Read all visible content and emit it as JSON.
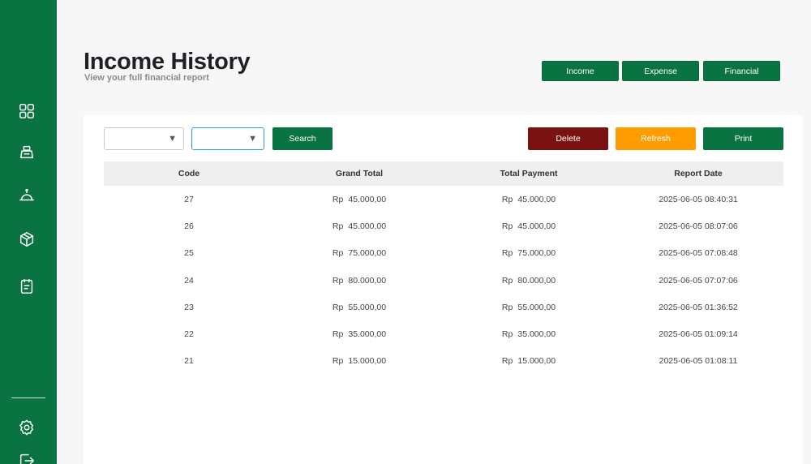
{
  "sidebar": {
    "icons": [
      "dashboard-icon",
      "cashier-icon",
      "food-cloche-icon",
      "package-icon",
      "report-icon",
      "settings-icon",
      "logout-icon"
    ]
  },
  "header": {
    "title": "Income History",
    "subtitle": "View your full financial report"
  },
  "top_nav": {
    "income_label": "Income",
    "expense_label": "Expense",
    "financial_label": "Financial"
  },
  "filters": {
    "select1_value": "",
    "select2_value": "",
    "search_label": "Search"
  },
  "actions": {
    "delete_label": "Delete",
    "refresh_label": "Refresh",
    "print_label": "Print"
  },
  "colors": {
    "brand_green": "#0a7342",
    "delete_red": "#7a1212",
    "refresh_orange": "#ff9d00"
  },
  "table": {
    "columns": [
      "Code",
      "Grand Total",
      "Total Payment",
      "Report Date"
    ],
    "currency": "Rp",
    "rows": [
      {
        "code": "27",
        "grand_total": "45.000,00",
        "total_payment": "45.000,00",
        "report_date": "2025-06-05 08:40:31"
      },
      {
        "code": "26",
        "grand_total": "45.000,00",
        "total_payment": "45.000,00",
        "report_date": "2025-06-05 08:07:06"
      },
      {
        "code": "25",
        "grand_total": "75.000,00",
        "total_payment": "75.000,00",
        "report_date": "2025-06-05 07:08:48"
      },
      {
        "code": "24",
        "grand_total": "80.000,00",
        "total_payment": "80.000,00",
        "report_date": "2025-06-05 07:07:06"
      },
      {
        "code": "23",
        "grand_total": "55.000,00",
        "total_payment": "55.000,00",
        "report_date": "2025-06-05 01:36:52"
      },
      {
        "code": "22",
        "grand_total": "35.000,00",
        "total_payment": "35.000,00",
        "report_date": "2025-06-05 01:09:14"
      },
      {
        "code": "21",
        "grand_total": "15.000,00",
        "total_payment": "15.000,00",
        "report_date": "2025-06-05 01:08:11"
      }
    ]
  }
}
